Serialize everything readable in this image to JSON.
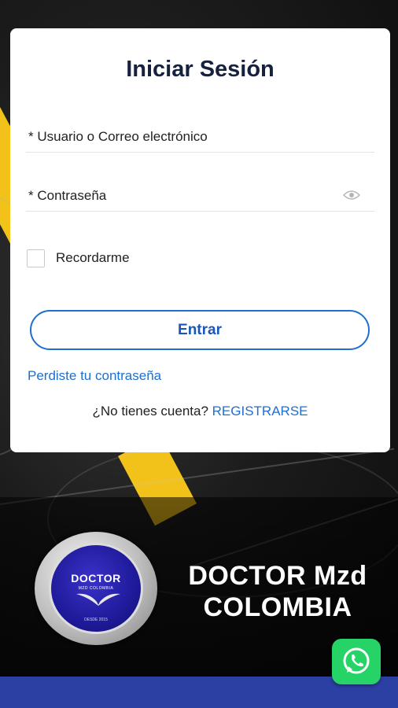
{
  "login": {
    "title": "Iniciar Sesión",
    "username_label": "* Usuario o Correo electrónico",
    "password_label": "* Contraseña",
    "remember_label": "Recordarme",
    "remember_checked": false,
    "submit_label": "Entrar",
    "forgot_link": "Perdiste tu contraseña",
    "no_account_text": "¿No tienes cuenta?",
    "register_link": "REGISTRARSE"
  },
  "banner": {
    "logo_title": "DOCTOR",
    "logo_subtitle": "MZD COLOMBIA",
    "logo_footer": "DESDE 2015",
    "brand_line1": "DOCTOR Mzd",
    "brand_line2": "COLOMBIA"
  },
  "icons": {
    "password_toggle": "eye-icon",
    "chat": "whatsapp-icon"
  },
  "colors": {
    "accent": "#1f6fd0",
    "title": "#16213d",
    "stripe": "#f2c21a",
    "bottom_bar": "#2c3fa3",
    "whatsapp": "#25d366"
  }
}
